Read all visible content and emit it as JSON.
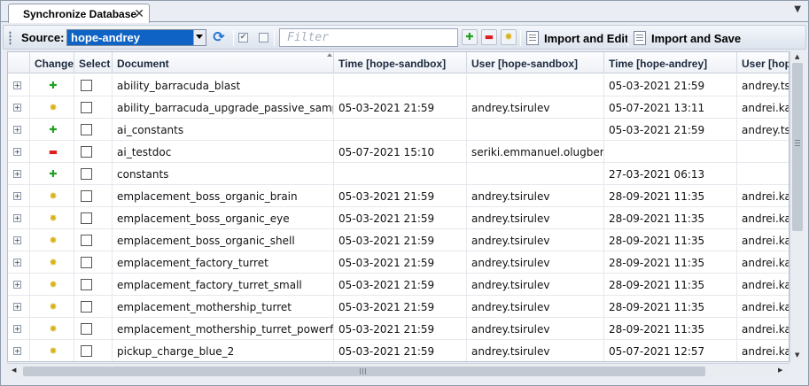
{
  "tab": {
    "title": "Synchronize Database",
    "close_glyph": "✕",
    "menu_glyph": "▼"
  },
  "toolbar": {
    "source_label": "Source:",
    "source_value": "hope-andrey",
    "filter_placeholder": "Filter",
    "add_glyph": "✚",
    "remove_glyph": "▬",
    "modify_glyph": "✸",
    "import_edit_label": "Import and Edit",
    "import_save_label": "Import and Save",
    "refresh_glyph": "⟳",
    "check_all_glyph": "✔"
  },
  "columns": {
    "change": "Change",
    "select": "Select",
    "document": "Document",
    "time_sandbox": "Time [hope-sandbox]",
    "user_sandbox": "User [hope-sandbox]",
    "time_andrey": "Time [hope-andrey]",
    "user_andrey": "User [hope-andrey]"
  },
  "change_glyphs": {
    "added": "✚",
    "removed": "▬",
    "modified": "✸"
  },
  "change_colors": {
    "added": "#1fa21f",
    "removed": "#dd1f1f",
    "modified": "#d8b41c"
  },
  "rows": [
    {
      "change": "added",
      "document": "ability_barracuda_blast",
      "time_sandbox": "",
      "user_sandbox": "",
      "time_andrey": "05-03-2021 21:59",
      "user_andrey": "andrey.tsirulev"
    },
    {
      "change": "modified",
      "document": "ability_barracuda_upgrade_passive_sample",
      "time_sandbox": "05-03-2021 21:59",
      "user_sandbox": "andrey.tsirulev",
      "time_andrey": "05-07-2021 13:11",
      "user_andrey": "andrei.kadyrov"
    },
    {
      "change": "added",
      "document": "ai_constants",
      "time_sandbox": "",
      "user_sandbox": "",
      "time_andrey": "05-03-2021 21:59",
      "user_andrey": "andrey.tsirulev"
    },
    {
      "change": "removed",
      "document": "ai_testdoc",
      "time_sandbox": "05-07-2021 15:10",
      "user_sandbox": "seriki.emmanuel.olugbenga",
      "time_andrey": "",
      "user_andrey": ""
    },
    {
      "change": "added",
      "document": "constants",
      "time_sandbox": "",
      "user_sandbox": "",
      "time_andrey": "27-03-2021 06:13",
      "user_andrey": ""
    },
    {
      "change": "modified",
      "document": "emplacement_boss_organic_brain",
      "time_sandbox": "05-03-2021 21:59",
      "user_sandbox": "andrey.tsirulev",
      "time_andrey": "28-09-2021 11:35",
      "user_andrey": "andrei.kadyrov"
    },
    {
      "change": "modified",
      "document": "emplacement_boss_organic_eye",
      "time_sandbox": "05-03-2021 21:59",
      "user_sandbox": "andrey.tsirulev",
      "time_andrey": "28-09-2021 11:35",
      "user_andrey": "andrei.kadyrov"
    },
    {
      "change": "modified",
      "document": "emplacement_boss_organic_shell",
      "time_sandbox": "05-03-2021 21:59",
      "user_sandbox": "andrey.tsirulev",
      "time_andrey": "28-09-2021 11:35",
      "user_andrey": "andrei.kadyrov"
    },
    {
      "change": "modified",
      "document": "emplacement_factory_turret",
      "time_sandbox": "05-03-2021 21:59",
      "user_sandbox": "andrey.tsirulev",
      "time_andrey": "28-09-2021 11:35",
      "user_andrey": "andrei.kadyrov"
    },
    {
      "change": "modified",
      "document": "emplacement_factory_turret_small",
      "time_sandbox": "05-03-2021 21:59",
      "user_sandbox": "andrey.tsirulev",
      "time_andrey": "28-09-2021 11:35",
      "user_andrey": "andrei.kadyrov"
    },
    {
      "change": "modified",
      "document": "emplacement_mothership_turret",
      "time_sandbox": "05-03-2021 21:59",
      "user_sandbox": "andrey.tsirulev",
      "time_andrey": "28-09-2021 11:35",
      "user_andrey": "andrei.kadyrov"
    },
    {
      "change": "modified",
      "document": "emplacement_mothership_turret_powerful",
      "time_sandbox": "05-03-2021 21:59",
      "user_sandbox": "andrey.tsirulev",
      "time_andrey": "28-09-2021 11:35",
      "user_andrey": "andrei.kadyrov"
    },
    {
      "change": "modified",
      "document": "pickup_charge_blue_2",
      "time_sandbox": "05-03-2021 21:59",
      "user_sandbox": "andrey.tsirulev",
      "time_andrey": "05-07-2021 12:57",
      "user_andrey": "andrei.kadyrov"
    }
  ]
}
